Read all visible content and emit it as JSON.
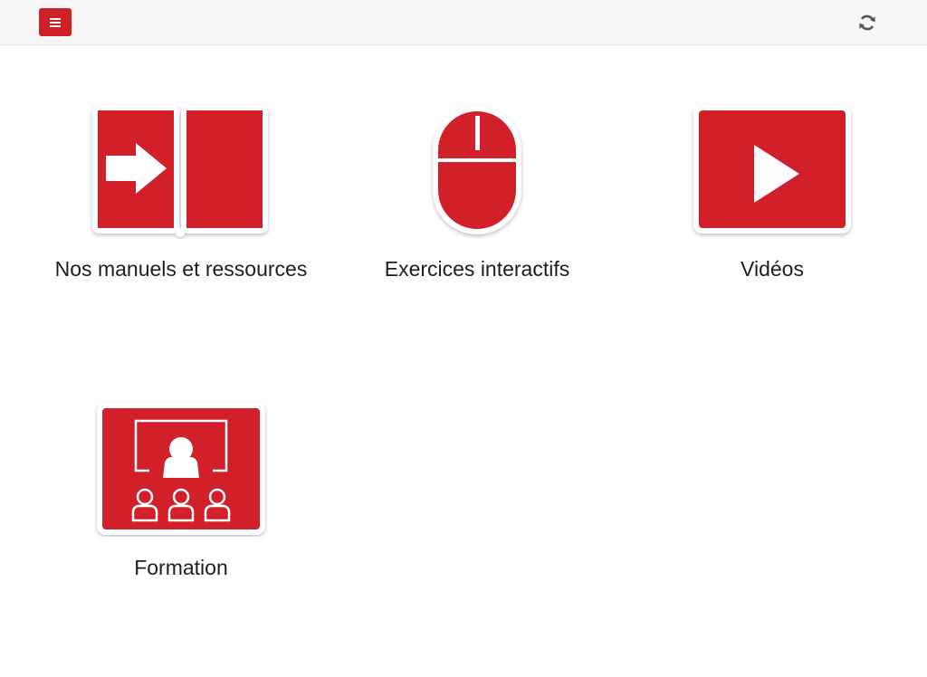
{
  "header": {
    "menu_icon": "hamburger-icon",
    "refresh_icon": "refresh-icon",
    "accent_color": "#cf2027"
  },
  "tiles": [
    {
      "label": "Nos manuels et ressources",
      "icon": "book-arrow-icon"
    },
    {
      "label": "Exercices interactifs",
      "icon": "mouse-icon"
    },
    {
      "label": "Vidéos",
      "icon": "play-video-icon"
    },
    {
      "label": "Formation",
      "icon": "classroom-training-icon"
    }
  ]
}
